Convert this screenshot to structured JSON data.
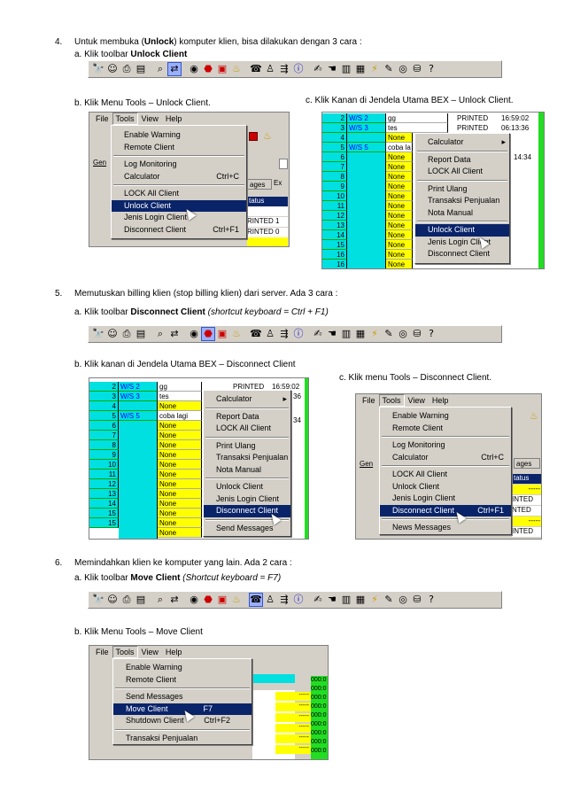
{
  "sec4": {
    "num": "4.",
    "title_pre": "Untuk membuka (",
    "title_bold": "Unlock",
    "title_post": ") komputer klien, bisa dilakukan dengan 3 cara :",
    "a_pre": "a.  Klik toolbar ",
    "a_bold": "Unlock Client",
    "b": "b.  Klik Menu Tools – Unlock Client.",
    "c": "c.   Klik Kanan di Jendela Utama BEX – Unlock Client."
  },
  "sec5": {
    "num": "5.",
    "title": "Memutuskan billing klien (stop billing klien) dari server. Ada 3 cara :",
    "a_pre": "a.  Klik toolbar ",
    "a_bold": "Disconnect Client",
    "a_italic": " (shortcut keyboard = Ctrl + F1)",
    "b": "b.  Klik kanan di Jendela Utama BEX – Disconnect Client",
    "c": "c.   Klik menu Tools – Disconnect Client."
  },
  "sec6": {
    "num": "6.",
    "title": "Memindahkan klien ke komputer yang lain. Ada 2 cara :",
    "a_pre": "a.  Klik toolbar ",
    "a_bold": "Move Client",
    "a_italic": " (Shortcut keyboard = F7)",
    "b": "b.  Klik Menu Tools – Move Client"
  },
  "menubar": {
    "file": "File",
    "tools": "Tools",
    "view": "View",
    "help": "Help"
  },
  "tools_menu": {
    "enable_warning": "Enable Warning",
    "remote_client": "Remote Client",
    "log_monitoring": "Log Monitoring",
    "calculator": "Calculator",
    "calc_sc": "Ctrl+C",
    "lock_all": "LOCK All Client",
    "unlock": "Unlock Client",
    "jenis_login": "Jenis Login Client",
    "disconnect": "Disconnect Client",
    "disconnect_sc": "Ctrl+F1",
    "news": "News Messages",
    "send": "Send Messages",
    "move": "Move Client",
    "move_sc": "F7",
    "shutdown": "Shutdown Client",
    "shutdown_sc": "Ctrl+F2",
    "transaksi": "Transaksi Penjualan"
  },
  "context_menu": {
    "calculator": "Calculator",
    "report": "Report Data",
    "lock_all": "LOCK All Client",
    "print": "Print Ulang",
    "transaksi": "Transaksi Penjualan",
    "nota": "Nota Manual",
    "unlock": "Unlock Client",
    "jenis_login": "Jenis Login Client",
    "disconnect": "Disconnect Client",
    "send": "Send Messages"
  },
  "grid": {
    "rows": [
      "2",
      "3",
      "4",
      "5",
      "6",
      "7",
      "8",
      "9",
      "10",
      "11",
      "12",
      "13",
      "14",
      "15",
      "16"
    ],
    "ws2": "W/S 2",
    "ws3": "W/S 3",
    "ws5": "W/S 5",
    "gg": "gg",
    "tes": "tes",
    "none": "None",
    "coba": "coba lagi",
    "coba_short": "coba la",
    "printed": "PRINTED",
    "t1": "16:59:02",
    "t2": "06:13:36",
    "t3": "14:34",
    "t2s": "36",
    "t3s": "34",
    "ages": "ages",
    "gen": "Gen",
    "status": "tatus",
    "inted": "INTED",
    "nted": "NTED",
    "printed_s": "RINTED",
    "dash": "-----",
    "ex": "Ex",
    "one": "1",
    "zero": "0",
    "tail": "000:0"
  },
  "icons": [
    "binoculars-icon",
    "smiley-icon",
    "printer-icon",
    "save-icon",
    "search-icon",
    "swap-icon",
    "eye-icon",
    "stop-icon",
    "window-icon",
    "cup-icon",
    "phone-icon",
    "people-icon",
    "transfer-icon",
    "info-icon",
    "pen-icon",
    "hand-icon",
    "chart-icon",
    "drawer-icon",
    "lightning-icon",
    "pencil-icon",
    "cd-icon",
    "db-icon",
    "help-icon"
  ]
}
